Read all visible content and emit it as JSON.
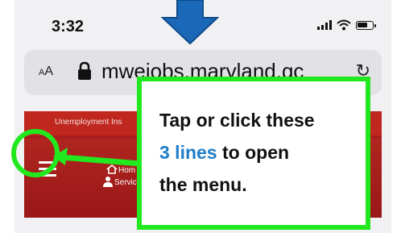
{
  "status_bar": {
    "time": "3:32",
    "icons": [
      "signal-icon",
      "wifi-icon",
      "battery-icon"
    ]
  },
  "browser": {
    "text_size_label": "AA",
    "url": "mwejobs.maryland.gc",
    "lock_icon": "lock-icon",
    "reload_icon": "reload-icon"
  },
  "site": {
    "banner_text": "Unemployment Ins",
    "nav_home": "Hom",
    "nav_services": "Services",
    "header_color": "#a81e1e"
  },
  "annotation": {
    "line1": "Tap or click these",
    "highlight": "3 lines",
    "line2_rest": "to open",
    "line3": "the menu.",
    "highlight_color": "#1f7dc7",
    "outline_color": "#22e81f",
    "arrow_color": "#1b67b8"
  }
}
